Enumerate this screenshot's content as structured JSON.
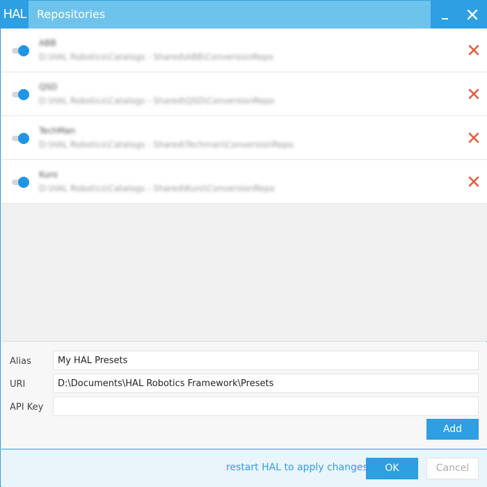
{
  "titlebar": {
    "logo": "HAL",
    "title": "Repositories",
    "accent_color": "#2d9fe2"
  },
  "repositories": [
    {
      "name": "ABB",
      "path": "D:\\HAL Robotics\\Catalogs - Shared\\ABB\\ConversionRepo",
      "enabled": true
    },
    {
      "name": "QSD",
      "path": "D:\\HAL Robotics\\Catalogs - Shared\\QSD\\ConversionRepo",
      "enabled": true
    },
    {
      "name": "TechMan",
      "path": "D:\\HAL Robotics\\Catalogs - Shared\\Techman\\ConversionRepo",
      "enabled": true
    },
    {
      "name": "Kuro",
      "path": "D:\\HAL Robotics\\Catalogs - Shared\\Kuro\\ConversionRepo",
      "enabled": true
    }
  ],
  "form": {
    "alias_label": "Alias",
    "alias_value": "My HAL Presets",
    "uri_label": "URI",
    "uri_value": "D:\\Documents\\HAL Robotics Framework\\Presets",
    "api_key_label": "API Key",
    "api_key_value": "",
    "add_label": "Add"
  },
  "footer": {
    "restart_text": "restart HAL to apply changes",
    "ok_label": "OK",
    "cancel_label": "Cancel"
  },
  "icons": {
    "minimize": "minimize-icon",
    "close": "close-icon",
    "delete": "delete-x-icon",
    "delete_color": "#e55b3c"
  }
}
